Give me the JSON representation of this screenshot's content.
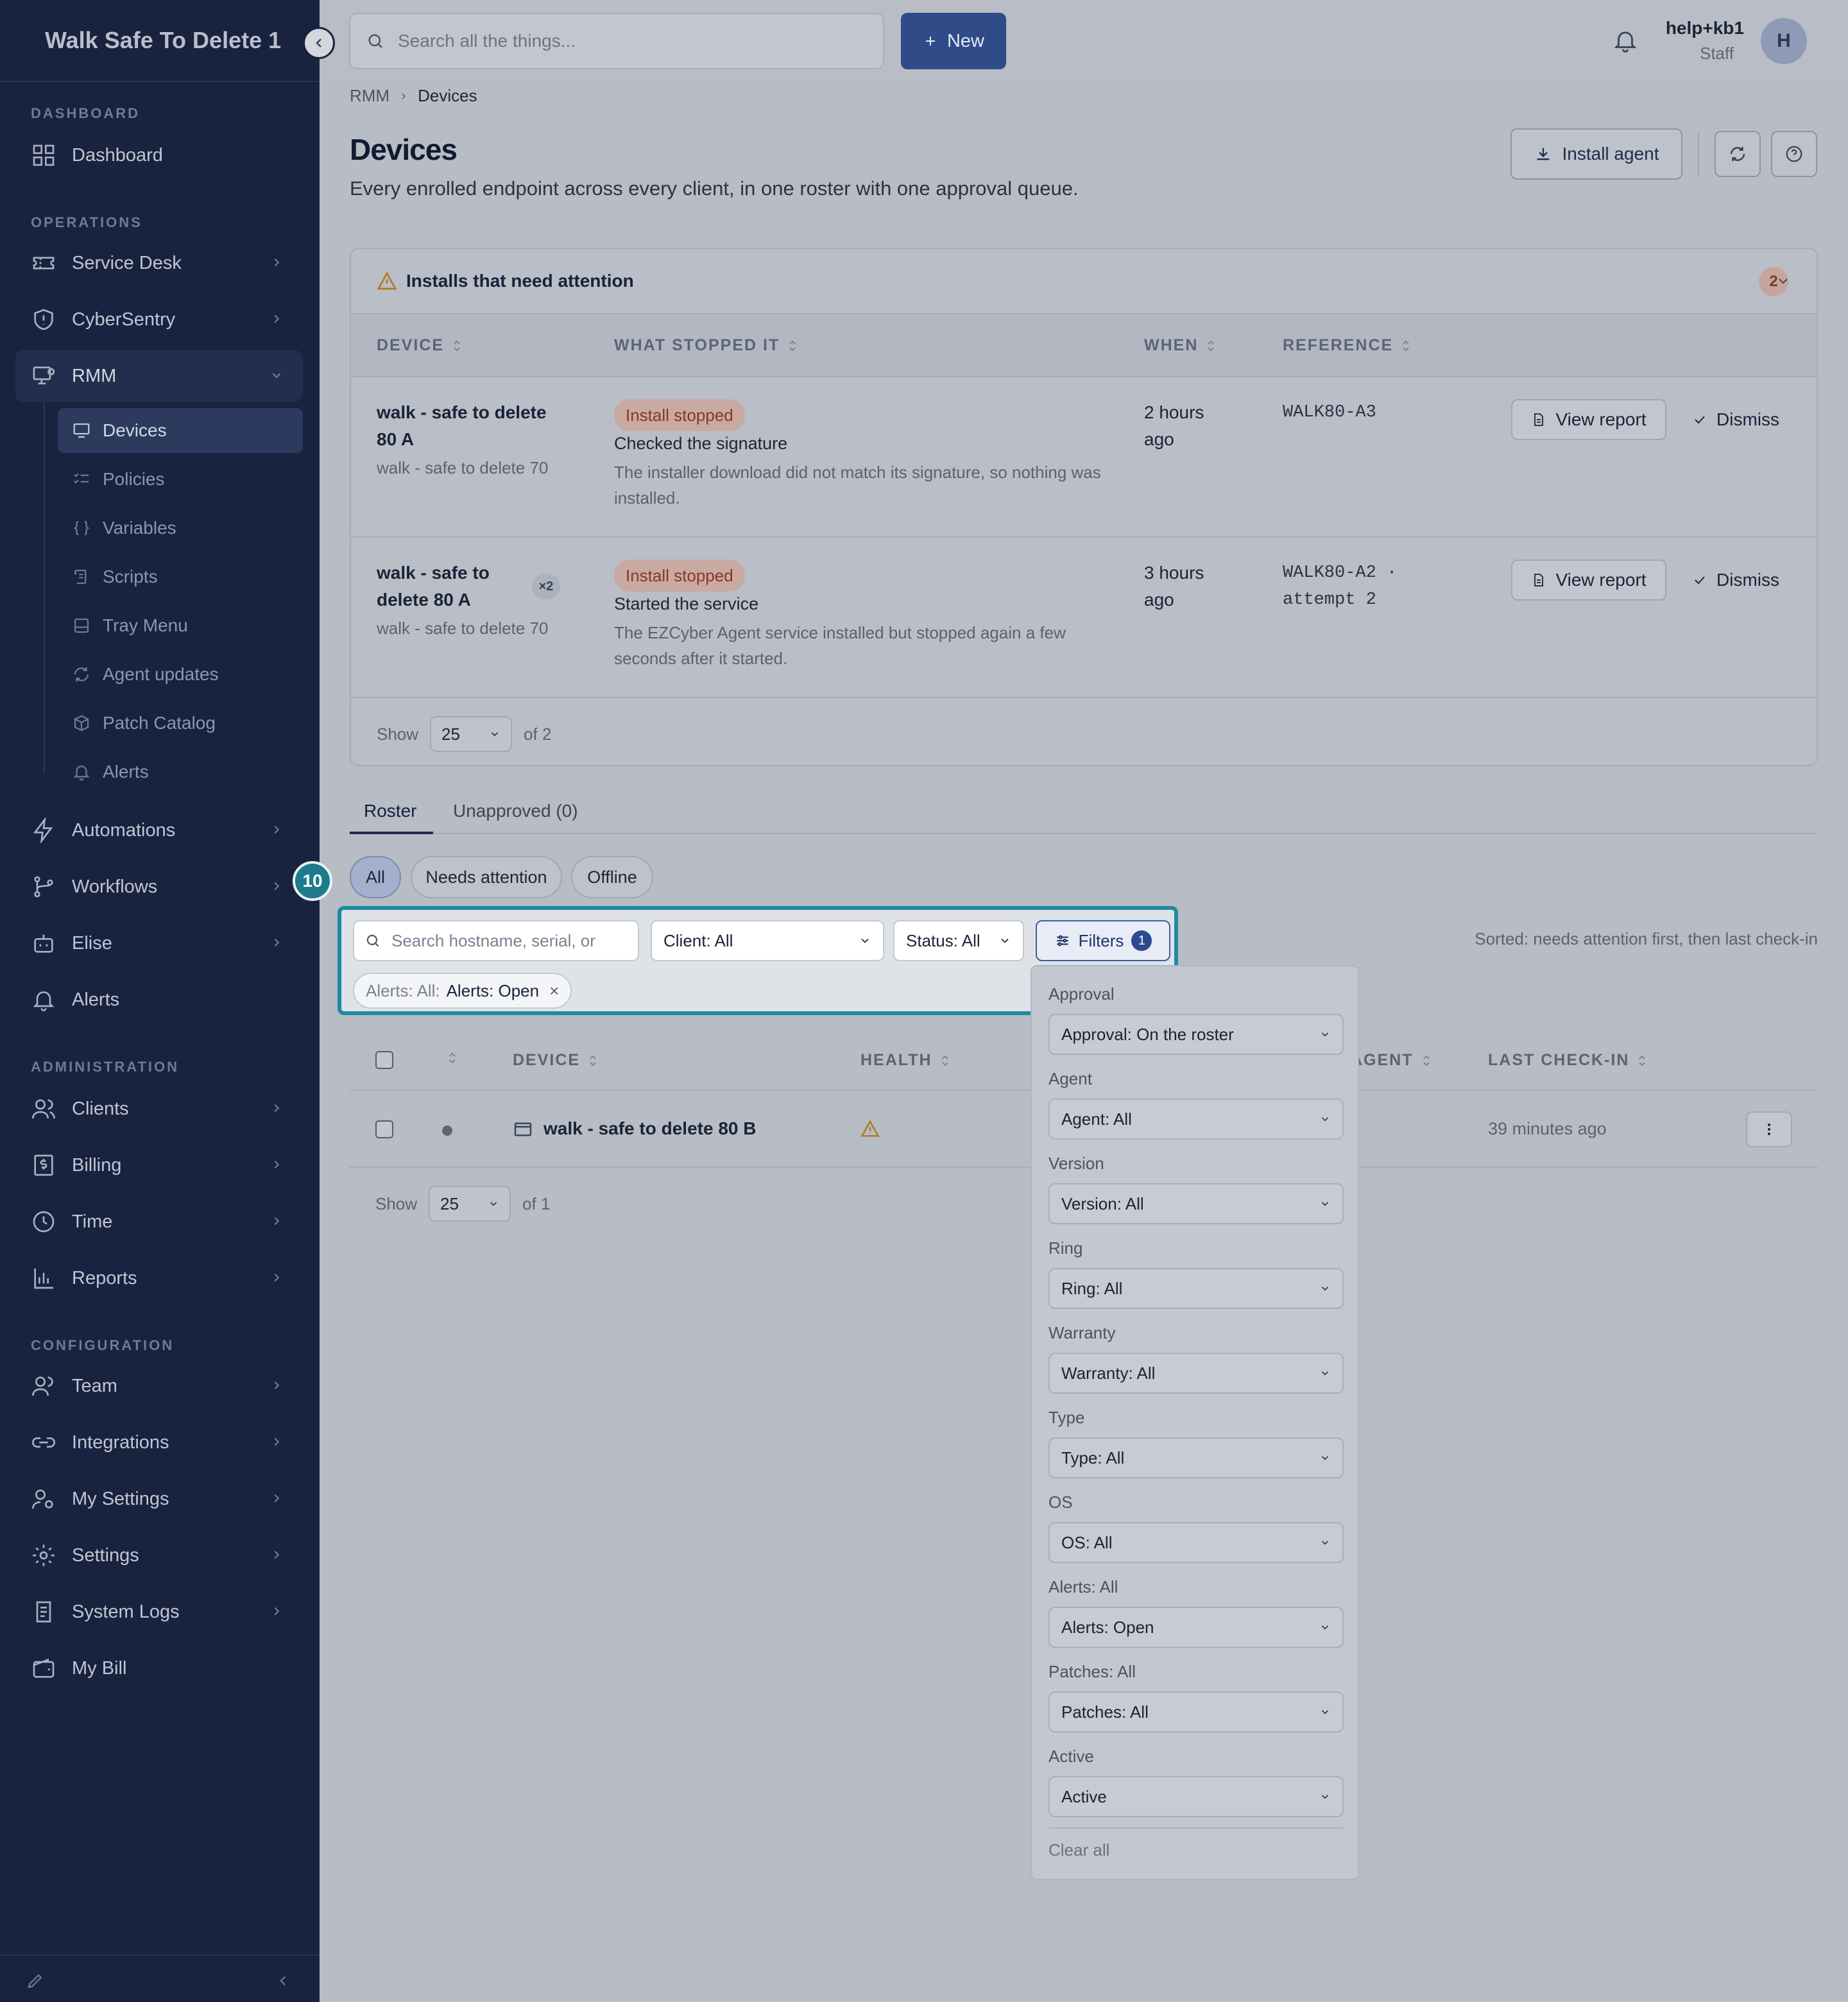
{
  "app": {
    "workspace_name": "Walk Safe To Delete 1"
  },
  "sidebar": {
    "sections": {
      "dashboard": "DASHBOARD",
      "operations": "OPERATIONS",
      "administration": "ADMINISTRATION",
      "configuration": "CONFIGURATION"
    },
    "items": {
      "dashboard": "Dashboard",
      "service_desk": "Service Desk",
      "cybersentry": "CyberSentry",
      "rmm": "RMM",
      "automations": "Automations",
      "workflows": "Workflows",
      "elise": "Elise",
      "alerts": "Alerts",
      "clients": "Clients",
      "billing": "Billing",
      "time": "Time",
      "reports": "Reports",
      "team": "Team",
      "integrations": "Integrations",
      "my_settings": "My Settings",
      "settings": "Settings",
      "system_logs": "System Logs",
      "my_bill": "My Bill"
    },
    "rmm_sub": [
      "Devices",
      "Policies",
      "Variables",
      "Scripts",
      "Tray Menu",
      "Agent updates",
      "Patch Catalog",
      "Alerts"
    ]
  },
  "topbar": {
    "search_placeholder": "Search all the things...",
    "new_label": "New",
    "user_name": "help+kb1",
    "user_role": "Staff",
    "avatar_initial": "H"
  },
  "breadcrumb": {
    "parent": "RMM",
    "current": "Devices"
  },
  "page": {
    "title": "Devices",
    "subtitle": "Every enrolled endpoint across every client, in one roster with one approval queue.",
    "install_agent_label": "Install agent"
  },
  "attention": {
    "title": "Installs that need attention",
    "count": "2",
    "columns": {
      "device": "DEVICE",
      "what": "WHAT STOPPED IT",
      "when": "WHEN",
      "reference": "REFERENCE"
    },
    "rows": [
      {
        "device": "walk - safe to delete 80 A",
        "client": "walk - safe to delete 70",
        "badge": "Install stopped",
        "reason": "Checked the signature",
        "detail": "The installer download did not match its signature, so nothing was installed.",
        "when": "2 hours ago",
        "reference": "WALK80-A3",
        "view_label": "View report",
        "dismiss_label": "Dismiss"
      },
      {
        "device": "walk - safe to delete 80 A",
        "multiplier": "×2",
        "client": "walk - safe to delete 70",
        "badge": "Install stopped",
        "reason": "Started the service",
        "detail": "The EZCyber Agent service installed but stopped again a few seconds after it started.",
        "when": "3 hours ago",
        "reference": "WALK80-A2 · attempt 2",
        "view_label": "View report",
        "dismiss_label": "Dismiss"
      }
    ],
    "footer": {
      "show_label": "Show",
      "page_size": "25",
      "of_label": "of 2"
    }
  },
  "tabs": {
    "roster": "Roster",
    "unapproved": "Unapproved (0)"
  },
  "chips": {
    "all": "All",
    "needs_attention": "Needs attention",
    "offline": "Offline"
  },
  "step_marker": "10",
  "filters": {
    "search_placeholder": "Search hostname, serial, or",
    "client": "Client: All",
    "status": "Status: All",
    "filters_label": "Filters",
    "filters_count": "1",
    "tag_key": "Alerts: All:",
    "tag_value": "Alerts: Open",
    "tag_remove": "×",
    "sorted_note": "Sorted: needs attention first, then last check-in"
  },
  "roster": {
    "columns": {
      "device": "DEVICE",
      "health": "HEALTH",
      "agent": "AGENT",
      "last_checkin": "LAST CHECK-IN"
    },
    "rows": [
      {
        "device": "walk - safe to delete 80 B",
        "last_checkin": "39 minutes ago"
      }
    ],
    "footer": {
      "show_label": "Show",
      "page_size": "25",
      "of_label": "of 1"
    }
  },
  "filter_panel": {
    "groups": [
      {
        "label": "Approval",
        "value": "Approval: On the roster"
      },
      {
        "label": "Agent",
        "value": "Agent: All"
      },
      {
        "label": "Version",
        "value": "Version: All"
      },
      {
        "label": "Ring",
        "value": "Ring: All"
      },
      {
        "label": "Warranty",
        "value": "Warranty: All"
      },
      {
        "label": "Type",
        "value": "Type: All"
      },
      {
        "label": "OS",
        "value": "OS: All"
      },
      {
        "label": "Alerts: All",
        "value": "Alerts: Open"
      },
      {
        "label": "Patches: All",
        "value": "Patches: All"
      },
      {
        "label": "Active",
        "value": "Active"
      }
    ],
    "clear_label": "Clear all"
  },
  "colors": {
    "sidebar": "#19233f",
    "primary": "#2f4b88",
    "highlight": "#1f8aa0",
    "warning": "#b07a22",
    "stopped": "#8a3626"
  }
}
